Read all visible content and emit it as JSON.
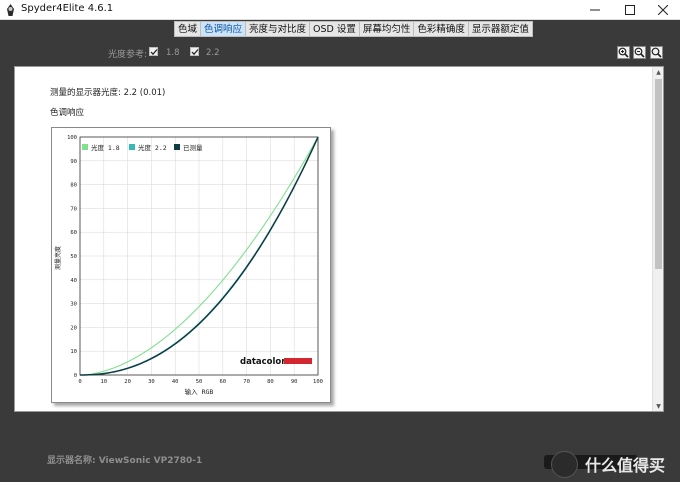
{
  "window": {
    "title": "Spyder4Elite 4.6.1"
  },
  "tabs": [
    {
      "label": "色域",
      "active": false
    },
    {
      "label": "色调响应",
      "active": true
    },
    {
      "label": "亮度与对比度",
      "active": false
    },
    {
      "label": "OSD 设置",
      "active": false
    },
    {
      "label": "屏幕均匀性",
      "active": false
    },
    {
      "label": "色彩精确度",
      "active": false
    },
    {
      "label": "显示器额定值",
      "active": false
    }
  ],
  "gamma_reference": {
    "label": "光度参考:",
    "options": [
      {
        "label": "1.8",
        "checked": true
      },
      {
        "label": "2.2",
        "checked": true
      }
    ]
  },
  "zoom_buttons": [
    "zoom-in-icon",
    "zoom-out-icon",
    "zoom-fit-icon"
  ],
  "report": {
    "measured_gamma": "测量的显示器光度:  2.2 (0.01)",
    "section_title": "色调响应"
  },
  "chart_data": {
    "type": "line",
    "xlabel": "输入 RGB",
    "ylabel": "测量亮度",
    "xlim": [
      0,
      100
    ],
    "ylim": [
      0,
      100
    ],
    "x_ticks": [
      0,
      10,
      20,
      30,
      40,
      50,
      60,
      70,
      80,
      90,
      100
    ],
    "y_ticks": [
      0,
      10,
      20,
      30,
      40,
      50,
      60,
      70,
      80,
      90,
      100
    ],
    "grid": true,
    "legend_position": "top-left",
    "brand": "datacolor",
    "series": [
      {
        "name": "光度 1.8",
        "color": "#7fe08f",
        "gamma": 1.8
      },
      {
        "name": "光度 2.2",
        "color": "#37b9b9",
        "gamma": 2.2
      },
      {
        "name": "已测量",
        "color": "#0e3c42",
        "gamma": 2.22
      }
    ]
  },
  "status": {
    "display_name": "显示器名称: ViewSonic VP2780-1"
  },
  "watermark": {
    "text": "什么值得买"
  },
  "colors": {
    "accent": "#0b56a6",
    "brand_red": "#d22630"
  }
}
